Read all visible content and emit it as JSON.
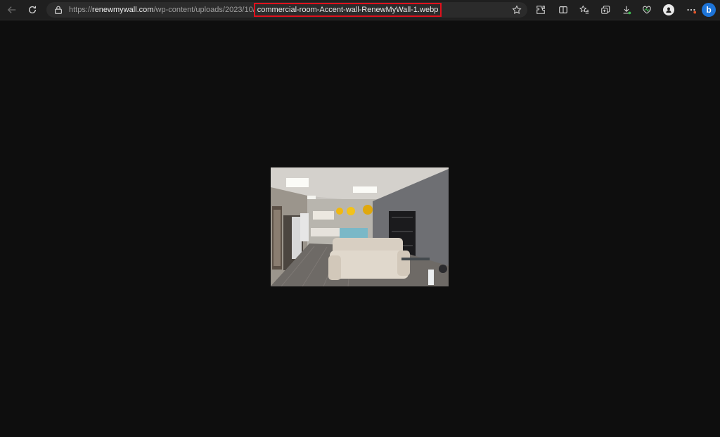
{
  "browser": {
    "address_bar": {
      "url_prefix": "https://",
      "url_host": "renewmywall.com",
      "url_path": "/wp-content/uploads/2023/10/",
      "url_file": "commercial-room-Accent-wall-RenewMyWall-1.webp"
    },
    "icons": {
      "back": "back-arrow-icon",
      "refresh": "refresh-icon",
      "lock": "lock-icon",
      "favorite": "star-icon",
      "extensions": "puzzle-icon",
      "split_screen": "split-screen-icon",
      "favorites": "favorites-icon",
      "collections": "collections-icon",
      "downloads": "download-icon",
      "performance": "heart-pulse-icon",
      "profile": "profile-avatar-icon",
      "more": "more-dots-icon",
      "copilot": "bing-icon"
    },
    "colors": {
      "toolbar": "#1f1f1f",
      "viewer_background": "#0e0e0e",
      "highlight_box": "#e0101c",
      "bing": "#1d74d8"
    }
  },
  "viewer": {
    "image": {
      "subject": "commercial room with gray accent wall, beige sofa, shelving and kitchenette"
    }
  }
}
